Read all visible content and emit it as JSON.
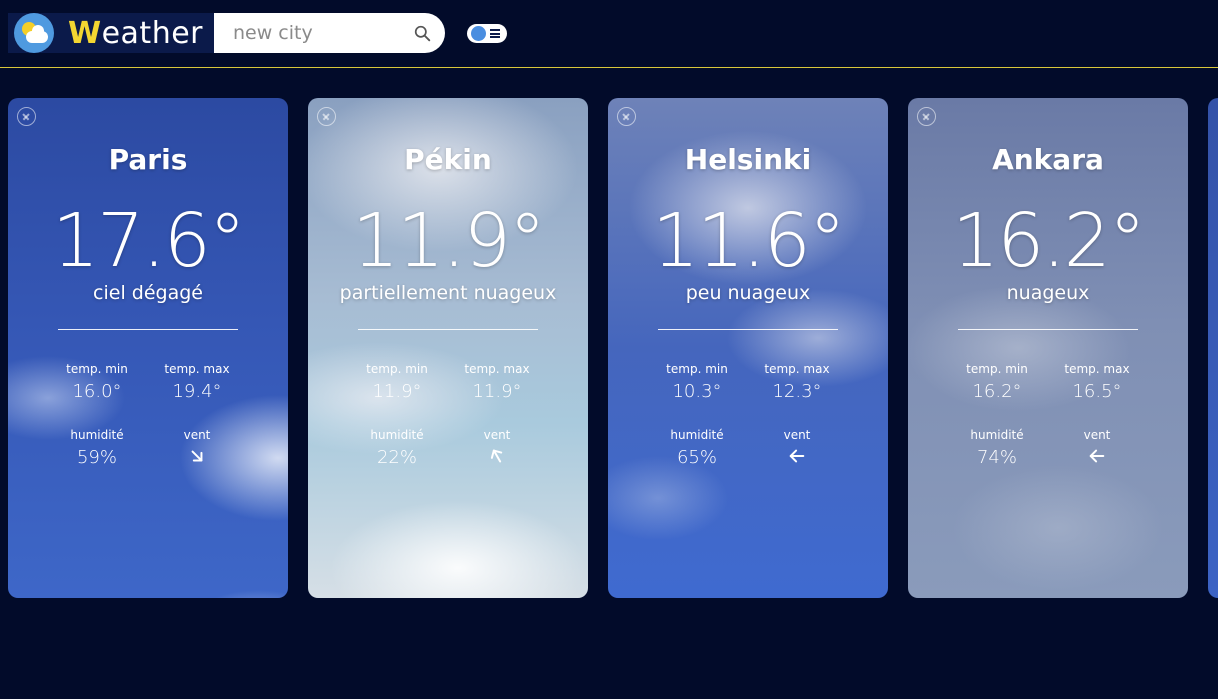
{
  "header": {
    "title_first_letter": "W",
    "title_rest": "eather",
    "search_placeholder": "new city",
    "accent_color": "#f3d631",
    "background_color": "#020b2a"
  },
  "labels": {
    "temp_min": "temp. min",
    "temp_max": "temp. max",
    "humidity": "humidité",
    "wind": "vent"
  },
  "cards": [
    {
      "city": "Paris",
      "temp": "17.6°",
      "description": "ciel dégagé",
      "temp_min": "16.0°",
      "temp_max": "19.4°",
      "humidity": "59%",
      "wind_direction": "south-east"
    },
    {
      "city": "Pékin",
      "temp": "11.9°",
      "description": "partiellement nuageux",
      "temp_min": "11.9°",
      "temp_max": "11.9°",
      "humidity": "22%",
      "wind_direction": "north-west"
    },
    {
      "city": "Helsinki",
      "temp": "11.6°",
      "description": "peu nuageux",
      "temp_min": "10.3°",
      "temp_max": "12.3°",
      "humidity": "65%",
      "wind_direction": "west"
    },
    {
      "city": "Ankara",
      "temp": "16.2°",
      "description": "nuageux",
      "temp_min": "16.2°",
      "temp_max": "16.5°",
      "humidity": "74%",
      "wind_direction": "west"
    }
  ]
}
